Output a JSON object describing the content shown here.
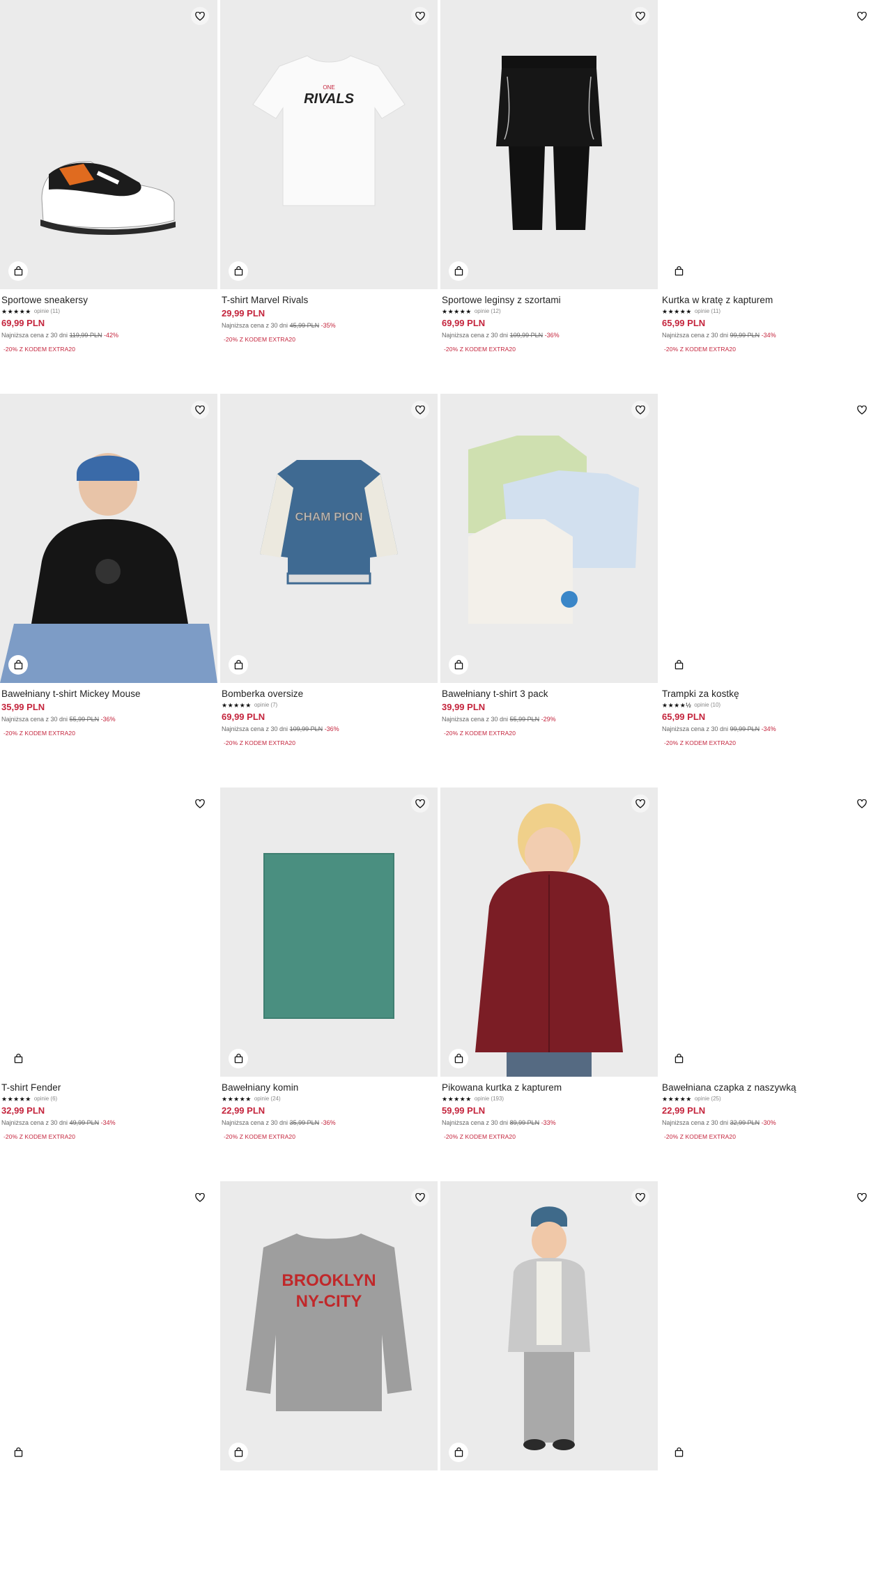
{
  "colors": {
    "price": "#c4243c",
    "promo": "#c4243c",
    "image_bg": "#ebebeb"
  },
  "icons": {
    "favorite": "heart-icon",
    "cart": "shopping-bag-icon",
    "star": "star-icon"
  },
  "products": [
    {
      "title": "Sportowe sneakersy",
      "stars": "★★★★★",
      "reviews": "opinie (11)",
      "price": "69,99 PLN",
      "lowest_label": "Najniższa cena z 30 dni",
      "old_price": "119,99 PLN",
      "discount": "-42%",
      "promo": "-20% Z KODEM EXTRA20"
    },
    {
      "title": "T-shirt Marvel Rivals",
      "stars": "",
      "reviews": "",
      "price": "29,99 PLN",
      "lowest_label": "Najniższa cena z 30 dni",
      "old_price": "45,99 PLN",
      "discount": "-35%",
      "promo": "-20% Z KODEM EXTRA20"
    },
    {
      "title": "Sportowe leginsy z szortami",
      "stars": "★★★★★",
      "reviews": "opinie (12)",
      "price": "69,99 PLN",
      "lowest_label": "Najniższa cena z 30 dni",
      "old_price": "109,99 PLN",
      "discount": "-36%",
      "promo": "-20% Z KODEM EXTRA20"
    },
    {
      "title": "Kurtka w kratę z kapturem",
      "stars": "★★★★★",
      "reviews": "opinie (11)",
      "price": "65,99 PLN",
      "lowest_label": "Najniższa cena z 30 dni",
      "old_price": "99,99 PLN",
      "discount": "-34%",
      "promo": "-20% Z KODEM EXTRA20"
    },
    {
      "title": "Bawełniany t-shirt Mickey Mouse",
      "stars": "",
      "reviews": "",
      "price": "35,99 PLN",
      "lowest_label": "Najniższa cena z 30 dni",
      "old_price": "55,99 PLN",
      "discount": "-36%",
      "promo": "-20% Z KODEM EXTRA20"
    },
    {
      "title": "Bomberka oversize",
      "stars": "★★★★★",
      "reviews": "opinie (7)",
      "price": "69,99 PLN",
      "lowest_label": "Najniższa cena z 30 dni",
      "old_price": "109,99 PLN",
      "discount": "-36%",
      "promo": "-20% Z KODEM EXTRA20"
    },
    {
      "title": "Bawełniany t-shirt 3 pack",
      "stars": "",
      "reviews": "",
      "price": "39,99 PLN",
      "lowest_label": "Najniższa cena z 30 dni",
      "old_price": "55,99 PLN",
      "discount": "-29%",
      "promo": "-20% Z KODEM EXTRA20"
    },
    {
      "title": "Trampki za kostkę",
      "stars": "★★★★½",
      "reviews": "opinie (10)",
      "price": "65,99 PLN",
      "lowest_label": "Najniższa cena z 30 dni",
      "old_price": "99,99 PLN",
      "discount": "-34%",
      "promo": "-20% Z KODEM EXTRA20"
    },
    {
      "title": "T-shirt Fender",
      "stars": "★★★★★",
      "reviews": "opinie (6)",
      "price": "32,99 PLN",
      "lowest_label": "Najniższa cena z 30 dni",
      "old_price": "49,99 PLN",
      "discount": "-34%",
      "promo": "-20% Z KODEM EXTRA20"
    },
    {
      "title": "Bawełniany komin",
      "stars": "★★★★★",
      "reviews": "opinie (24)",
      "price": "22,99 PLN",
      "lowest_label": "Najniższa cena z 30 dni",
      "old_price": "35,99 PLN",
      "discount": "-36%",
      "promo": "-20% Z KODEM EXTRA20"
    },
    {
      "title": "Pikowana kurtka z kapturem",
      "stars": "★★★★★",
      "reviews": "opinie (193)",
      "price": "59,99 PLN",
      "lowest_label": "Najniższa cena z 30 dni",
      "old_price": "89,99 PLN",
      "discount": "-33%",
      "promo": "-20% Z KODEM EXTRA20"
    },
    {
      "title": "Bawełniana czapka z naszywką",
      "stars": "★★★★★",
      "reviews": "opinie (25)",
      "price": "22,99 PLN",
      "lowest_label": "Najniższa cena z 30 dni",
      "old_price": "32,99 PLN",
      "discount": "-30%",
      "promo": "-20% Z KODEM EXTRA20"
    }
  ],
  "artwork": {
    "rivals_small": "ONE",
    "rivals_big": "RIVALS",
    "champion": "CHAM PION",
    "sweater_line1": "BROOKLYN",
    "sweater_line2": "NY-CITY"
  }
}
